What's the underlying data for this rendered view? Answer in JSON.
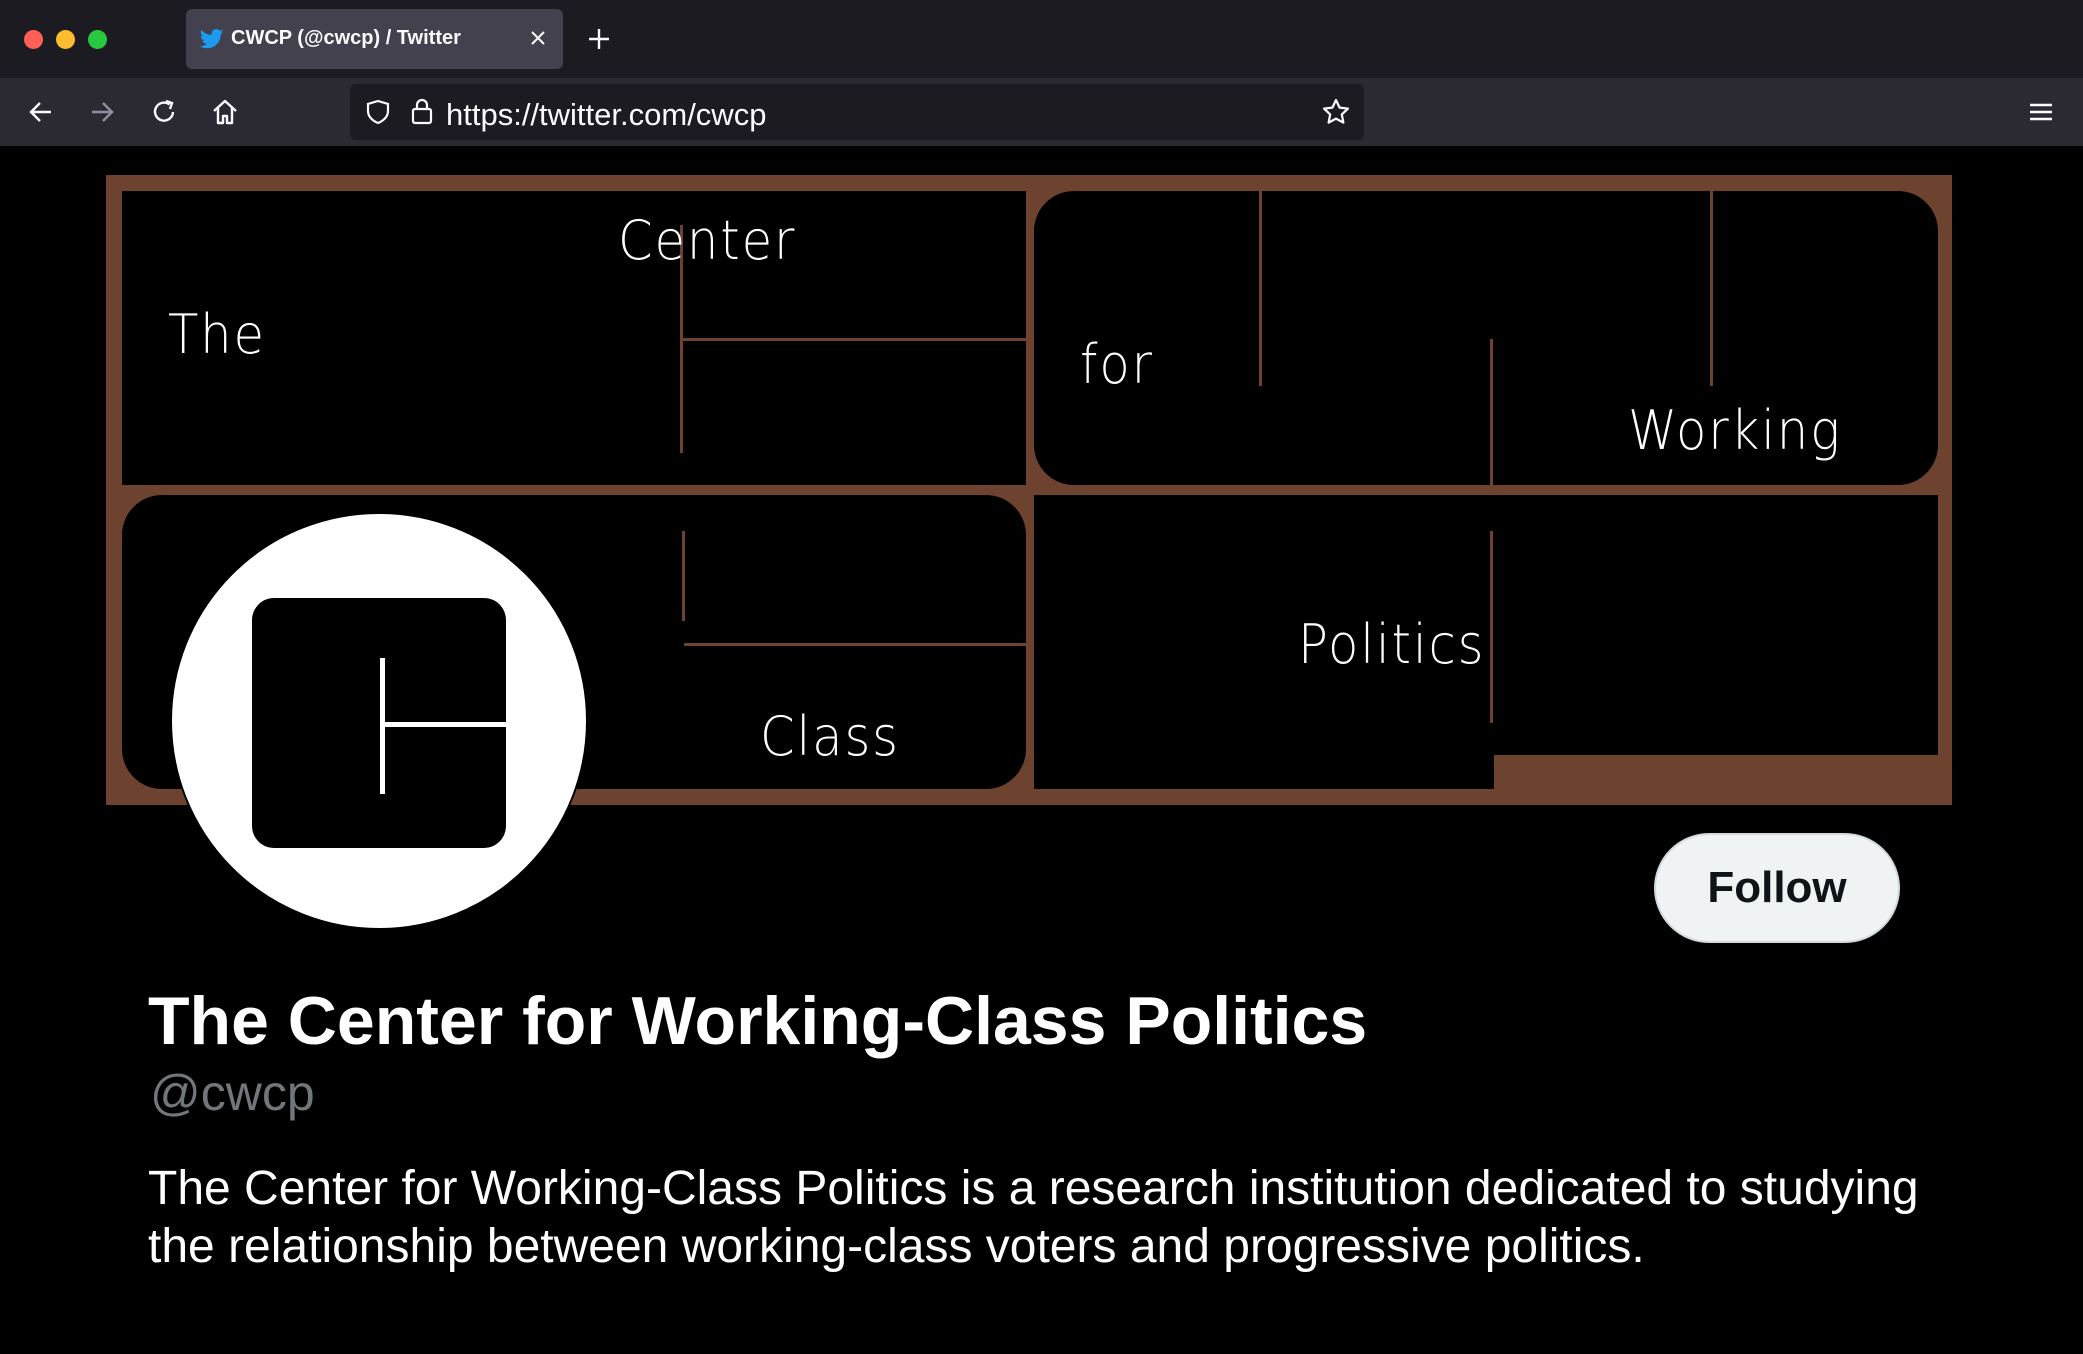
{
  "browser": {
    "tab_title": "CWCP (@cwcp) / Twitter",
    "url": "https://twitter.com/cwcp",
    "icons": [
      "twitter-bird-icon",
      "close-icon",
      "plus-icon",
      "back-arrow-icon",
      "forward-arrow-icon",
      "reload-icon",
      "home-icon",
      "shield-icon",
      "lock-icon",
      "star-icon",
      "hamburger-menu-icon"
    ]
  },
  "banner": {
    "words": {
      "the": "The",
      "center": "Center",
      "for": "for",
      "working": "Working",
      "class": "Class",
      "politics": "Politics"
    },
    "colors": {
      "accent": "#6d4330",
      "panel": "#000000"
    }
  },
  "profile": {
    "display_name": "The Center for Working-Class Politics",
    "handle": "@cwcp",
    "bio": "The Center for Working-Class Politics is a research institution dedicated to studying the relationship between working-class voters and progressive politics.",
    "follow_label": "Follow"
  }
}
